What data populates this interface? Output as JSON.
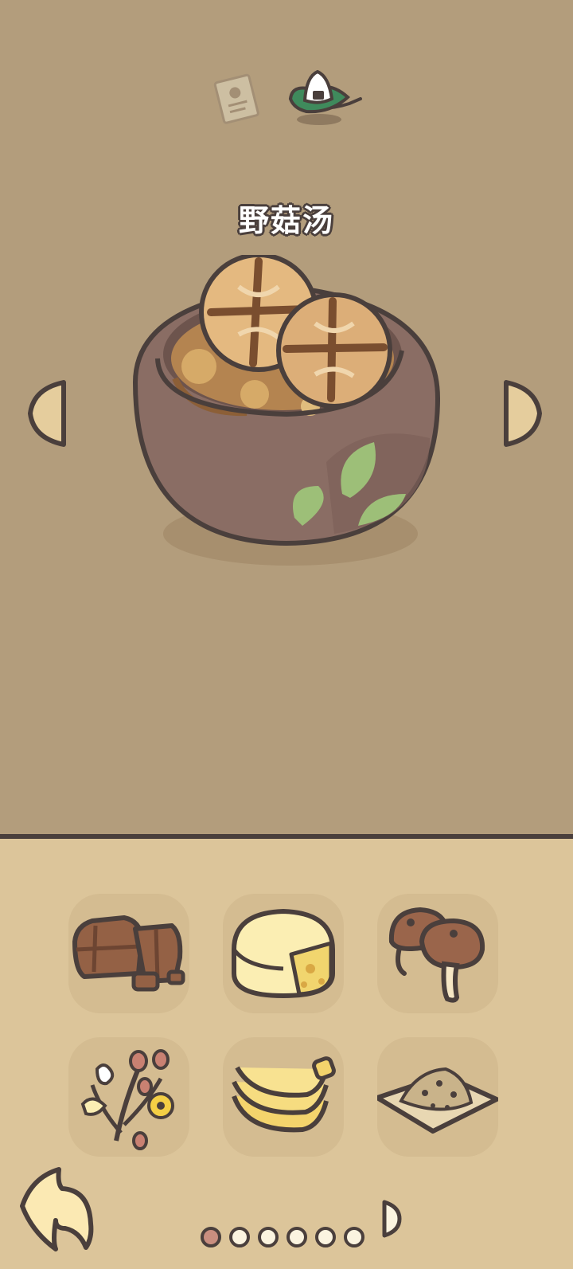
{
  "recipe": {
    "name": "野菇汤"
  },
  "tabs": [
    {
      "icon": "recipe-paper-icon",
      "selected": false
    },
    {
      "icon": "rice-ball-icon",
      "selected": true
    }
  ],
  "ingredients": [
    {
      "icon": "chocolate-icon"
    },
    {
      "icon": "cheese-icon"
    },
    {
      "icon": "mushroom-icon"
    },
    {
      "icon": "flower-bouquet-icon"
    },
    {
      "icon": "banana-icon"
    },
    {
      "icon": "grain-pile-icon"
    }
  ],
  "pagination": {
    "total": 6,
    "current": 1
  },
  "colors": {
    "top_background": "#b39d7c",
    "bottom_background": "#dcc59a",
    "cell_background": "#d4bc91",
    "outline": "#4a3f3c",
    "active_dot": "#c98e7f",
    "pot": "#8a6d64",
    "leaf": "#9dbf78"
  }
}
